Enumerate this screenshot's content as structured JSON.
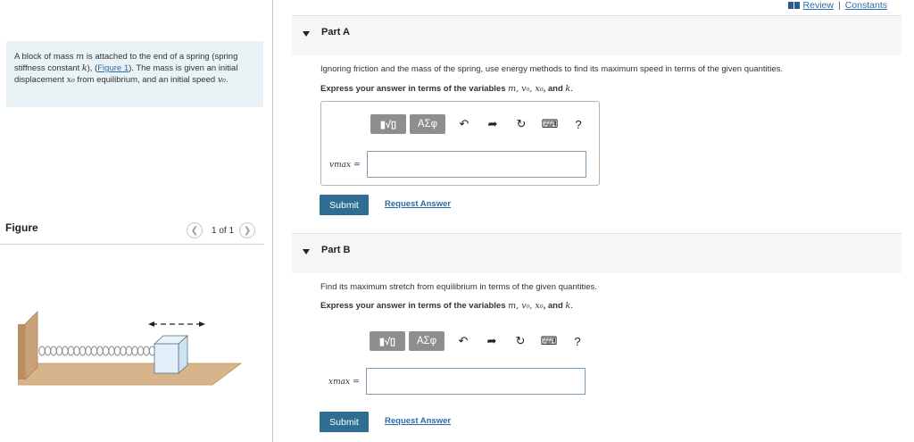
{
  "header": {
    "review_label": "Review",
    "separator": "|",
    "constants_label": "Constants"
  },
  "problem": {
    "text_1": "A block of mass ",
    "var_m": "m",
    "text_2": " is attached to the end of a spring (spring stiffness constant ",
    "var_k": "k",
    "text_3": "), (",
    "figure_link": "Figure 1",
    "text_4": "). The mass is given an initial displacement ",
    "var_x0": "x₀",
    "text_5": " from equilibrium, and an initial speed ",
    "var_v0": "v₀",
    "text_6": "."
  },
  "figure": {
    "title": "Figure",
    "pager_label": "1 of 1",
    "prev_icon": "chevron-left-icon",
    "next_icon": "chevron-right-icon"
  },
  "parts": [
    {
      "title": "Part A",
      "question": "Ignoring friction and the mass of the spring, use energy methods to find its maximum speed in terms of the given quantities.",
      "instruction": "Express your answer in terms of the variables",
      "variables": "m, v₀, x₀",
      "and_word": ", and",
      "last_var": "k.",
      "answer_label": "vmax",
      "answer_value": "",
      "submit_label": "Submit",
      "request_label": "Request Answer"
    },
    {
      "title": "Part B",
      "question": "Find its maximum stretch from equilibrium in terms of the given quantities.",
      "instruction": "Express your answer in terms of the variables",
      "variables": "m, v₀, x₀",
      "and_word": ", and",
      "last_var": "k.",
      "answer_label": "xmax",
      "answer_value": "",
      "submit_label": "Submit",
      "request_label": "Request Answer"
    }
  ],
  "toolbar": {
    "template_label": "▮√▯",
    "greek_label": "ΑΣφ",
    "undo_icon": "undo-icon",
    "redo_icon": "redo-icon",
    "reset_icon": "reset-icon",
    "keyboard_icon": "keyboard-icon",
    "help_label": "?"
  },
  "colors": {
    "problem_bg": "#e9f3f6",
    "submit_bg": "#2f6d92",
    "link": "#2a6da8",
    "toolbar_btn": "#8e8e8e"
  }
}
